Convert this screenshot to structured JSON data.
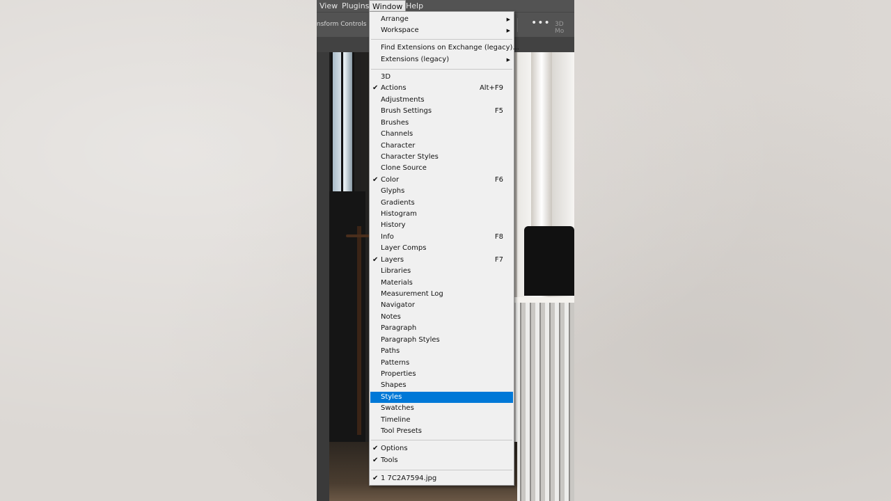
{
  "menubar": [
    "View",
    "Plugins",
    "Window",
    "Help"
  ],
  "options_bar": {
    "transform_controls": "nsform Controls",
    "more": "•••",
    "mode": "3D Mo"
  },
  "window_menu": {
    "arrange": "Arrange",
    "workspace": "Workspace",
    "find_extensions": "Find Extensions on Exchange (legacy)...",
    "extensions": "Extensions (legacy)",
    "panels": [
      {
        "label": "3D",
        "checked": false,
        "shortcut": ""
      },
      {
        "label": "Actions",
        "checked": true,
        "shortcut": "Alt+F9"
      },
      {
        "label": "Adjustments",
        "checked": false,
        "shortcut": ""
      },
      {
        "label": "Brush Settings",
        "checked": false,
        "shortcut": "F5"
      },
      {
        "label": "Brushes",
        "checked": false,
        "shortcut": ""
      },
      {
        "label": "Channels",
        "checked": false,
        "shortcut": ""
      },
      {
        "label": "Character",
        "checked": false,
        "shortcut": ""
      },
      {
        "label": "Character Styles",
        "checked": false,
        "shortcut": ""
      },
      {
        "label": "Clone Source",
        "checked": false,
        "shortcut": ""
      },
      {
        "label": "Color",
        "checked": true,
        "shortcut": "F6"
      },
      {
        "label": "Glyphs",
        "checked": false,
        "shortcut": ""
      },
      {
        "label": "Gradients",
        "checked": false,
        "shortcut": ""
      },
      {
        "label": "Histogram",
        "checked": false,
        "shortcut": ""
      },
      {
        "label": "History",
        "checked": false,
        "shortcut": ""
      },
      {
        "label": "Info",
        "checked": false,
        "shortcut": "F8"
      },
      {
        "label": "Layer Comps",
        "checked": false,
        "shortcut": ""
      },
      {
        "label": "Layers",
        "checked": true,
        "shortcut": "F7"
      },
      {
        "label": "Libraries",
        "checked": false,
        "shortcut": ""
      },
      {
        "label": "Materials",
        "checked": false,
        "shortcut": ""
      },
      {
        "label": "Measurement Log",
        "checked": false,
        "shortcut": ""
      },
      {
        "label": "Navigator",
        "checked": false,
        "shortcut": ""
      },
      {
        "label": "Notes",
        "checked": false,
        "shortcut": ""
      },
      {
        "label": "Paragraph",
        "checked": false,
        "shortcut": ""
      },
      {
        "label": "Paragraph Styles",
        "checked": false,
        "shortcut": ""
      },
      {
        "label": "Paths",
        "checked": false,
        "shortcut": ""
      },
      {
        "label": "Patterns",
        "checked": false,
        "shortcut": ""
      },
      {
        "label": "Properties",
        "checked": false,
        "shortcut": ""
      },
      {
        "label": "Shapes",
        "checked": false,
        "shortcut": ""
      },
      {
        "label": "Styles",
        "checked": false,
        "shortcut": "",
        "highlighted": true
      },
      {
        "label": "Swatches",
        "checked": false,
        "shortcut": ""
      },
      {
        "label": "Timeline",
        "checked": false,
        "shortcut": ""
      },
      {
        "label": "Tool Presets",
        "checked": false,
        "shortcut": ""
      }
    ],
    "toolbars": [
      {
        "label": "Options",
        "checked": true
      },
      {
        "label": "Tools",
        "checked": true
      }
    ],
    "documents": [
      {
        "label": "1 7C2A7594.jpg",
        "checked": true
      }
    ],
    "check_glyph": "✔",
    "submenu_arrow": "▶"
  },
  "colors": {
    "highlight": "#0078d7",
    "menu_bg": "#f0f0f0",
    "menubar_bg": "#535353"
  },
  "icons": [
    "checkmark-icon",
    "submenu-arrow-icon"
  ]
}
